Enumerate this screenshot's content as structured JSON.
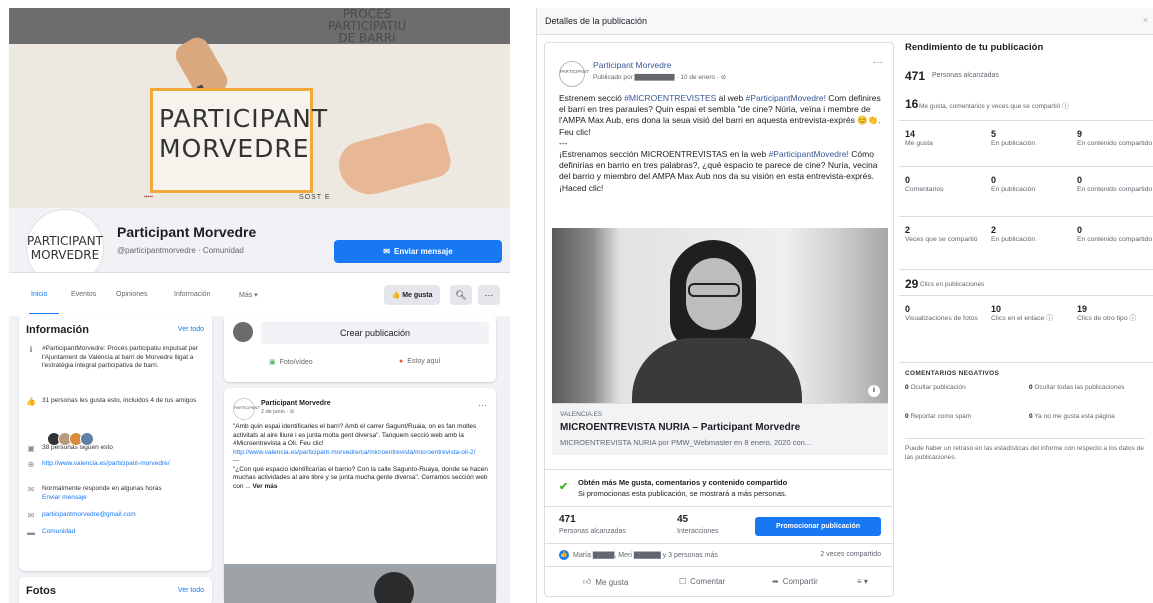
{
  "left": {
    "cover": {
      "title_line1": "PARTICIPANT",
      "title_line2": "MORVEDRE",
      "barri_line1": "PROCÉS",
      "barri_line2": "PARTICIPATIU",
      "barri_line3": "DE BARRI",
      "sostre": "SOST E",
      "logos": "▪▪▪▪▪"
    },
    "profile_logo": "PARTICIPANT MORVEDRE",
    "page_name": "Participant Morvedre",
    "page_handle": "@participantmorvedre · Comunidad",
    "send_button": "Enviar mensaje",
    "tabs": [
      "Inicio",
      "Eventos",
      "Opiniones",
      "Información",
      "Más ▾"
    ],
    "like_button": "Me gusta",
    "info": {
      "title": "Información",
      "ver_todo": "Ver todo",
      "description": "#ParticipantMorvedre: Procés participatiu impulsat per l'Ajuntament de València al barri de Morvedre lligat a l'estratègia integral participativa de barri.",
      "likes": "31 personas les gusta esto, incluidos 4 de tus amigos",
      "followers": "38 personas siguen esto",
      "website": "http://www.valencia.es/participant-morvedre/",
      "response": "Normalmente responde en algunas horas",
      "send_message": "Enviar mensaje",
      "email": "participantmorvedre@gmail.com",
      "category": "Comunidad"
    },
    "photos": {
      "title": "Fotos",
      "ver_todo": "Ver todo"
    },
    "create": {
      "button": "Crear publicación",
      "photo_video": "Foto/vídeo",
      "checkin": "Estoy aquí"
    },
    "post": {
      "author": "Participant Morvedre",
      "date": "2 de junio · ⊘",
      "body1": "\"Amb quin espai identificaries el barri? Amb el carrer Sagunt/Ruaia, on es fan moltes activitats al aire lliure i es junta molta gent diversa\". Tanquem secció web amb la #Microentrevista a Oli. Feu clic!",
      "link": "http://www.valencia.es/participant-morvedre/ca/microentrevista/microentrevista-oli-2/",
      "sep": "---",
      "body2": "\"¿Con qué espacio identificarías el barrio? Con la calle Sagunto-Ruaya, donde se hacen muchas actividades al aire libre y se junta mucha gente diversa\". Cerramos sección web con ...",
      "ver_mas": "Ver más"
    }
  },
  "dialog": {
    "title": "Detalles de la publicación",
    "close": "×",
    "post": {
      "author": "Participant Morvedre",
      "published_by": "Publicado por ▇▇▇▇▇▇▇▇ · 10 de enero · ⊘",
      "body_ca_1": "Estrenem secció ",
      "hashtag1": "#MICROENTREVISTES",
      "body_ca_2": " al web ",
      "hashtag2": "#ParticipantMovedre!",
      "body_ca_3": " Com definires el barri en tres paraules? Quin espai et sembla \"de cine? Núria, veïna i membre de l'AMPA Max Aub, ens dona la seua visió del barri en aquesta entrevista-exprés 😊👏. Feu clic!",
      "sep": "---",
      "body_es_1": "¡Estrenamos sección MICROENTREVISTAS en la web ",
      "hashtag3": "#ParticipantMovedre!",
      "body_es_2": " Cómo definirías en barrio en tres palabras?, ¿qué espacio te parece de cine? Nuria, vecina del barrio y miembro del AMPA Max Aub nos da su visión en esta entrevista-exprés. ¡Haced clic!",
      "link_domain": "VALENCIA.ES",
      "link_title": "MICROENTREVISTA NURIA – Participant Morvedre",
      "link_sub": "MICROENTREVISTA NURIA por PMW_Webmaster en 8 enero, 2020 con...",
      "boost_title": "Obtén más Me gusta, comentarios y contenido compartido",
      "boost_sub": "Si promocionas esta publicación, se mostrará a más personas.",
      "reach_value": "471",
      "reach_label": "Personas alcanzadas",
      "interactions_value": "45",
      "interactions_label": "Interacciones",
      "promote_button": "Promocionar publicación",
      "likers": "María ▇▇▇▇, Meri ▇▇▇▇▇ y 3 personas más",
      "shares": "2 veces compartido",
      "action_like": "Me gusta",
      "action_comment": "Comentar",
      "action_share": "Compartir",
      "action_more": "≡ ▾"
    },
    "metrics": {
      "title": "Rendimiento de tu publicación",
      "reach": "471",
      "reach_label": "Personas alcanzadas",
      "interactions": "16",
      "interactions_label": "Me gusta, comentarios y veces que se compartió ⓘ",
      "rows": [
        [
          {
            "v": "14",
            "l": "Me gusta"
          },
          {
            "v": "5",
            "l": "En publicación"
          },
          {
            "v": "9",
            "l": "En contenido compartido"
          }
        ],
        [
          {
            "v": "0",
            "l": "Comentarios"
          },
          {
            "v": "0",
            "l": "En publicación"
          },
          {
            "v": "0",
            "l": "En contenido compartido"
          }
        ],
        [
          {
            "v": "2",
            "l": "Veces que se compartió"
          },
          {
            "v": "2",
            "l": "En publicación"
          },
          {
            "v": "0",
            "l": "En contenido compartido"
          }
        ]
      ],
      "clicks": "29",
      "clicks_label": "Clics en publicaciones",
      "click_row": [
        {
          "v": "0",
          "l": "Visualizaciones de fotos"
        },
        {
          "v": "10",
          "l": "Clics en el enlace ⓘ"
        },
        {
          "v": "19",
          "l": "Clics de otro tipo ⓘ"
        }
      ],
      "negative_title": "COMENTARIOS NEGATIVOS",
      "negative": [
        {
          "v": "0",
          "l": "Ocultar publicación"
        },
        {
          "v": "0",
          "l": "Ocultar todas las publicaciones"
        },
        {
          "v": "0",
          "l": "Reportar como spam"
        },
        {
          "v": "0",
          "l": "Ya no me gusta esta página"
        }
      ],
      "note": "Puede haber un retraso en las estadísticas del informe con respecto a los datos de las publicaciones."
    }
  }
}
